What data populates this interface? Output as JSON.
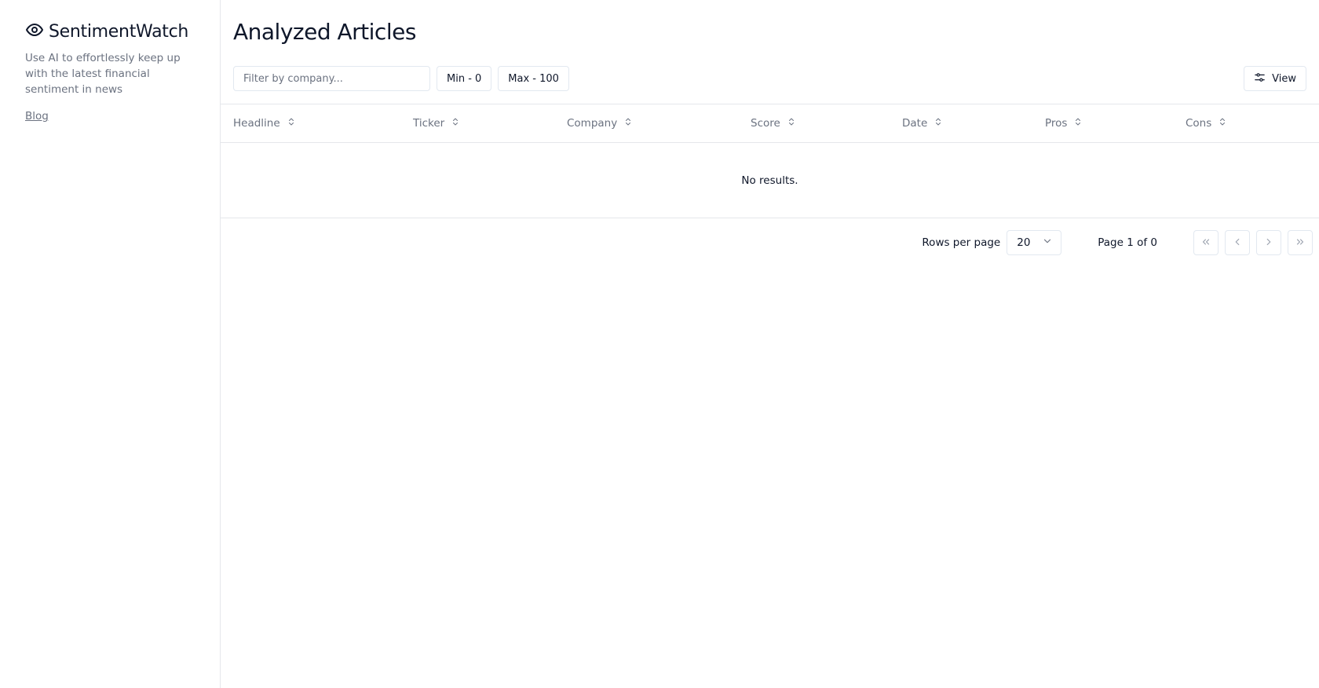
{
  "sidebar": {
    "brand_name": "SentimentWatch",
    "brand_icon": "eye-icon",
    "tagline": "Use AI to effortlessly keep up with the latest financial sentiment in news",
    "blog_label": "Blog"
  },
  "main": {
    "title": "Analyzed Articles",
    "filter": {
      "placeholder": "Filter by company...",
      "value": ""
    },
    "min_label": "Min - 0",
    "max_label": "Max - 100",
    "view_label": "View"
  },
  "table": {
    "columns": [
      {
        "label": "Headline"
      },
      {
        "label": "Ticker"
      },
      {
        "label": "Company"
      },
      {
        "label": "Score"
      },
      {
        "label": "Date"
      },
      {
        "label": "Pros"
      },
      {
        "label": "Cons"
      }
    ],
    "empty_text": "No results."
  },
  "pagination": {
    "rows_label": "Rows per page",
    "rows_value": "20",
    "page_info": "Page 1 of 0"
  },
  "colors": {
    "text": "#0f172a",
    "muted": "#6b7280",
    "border": "#e5e7eb"
  }
}
